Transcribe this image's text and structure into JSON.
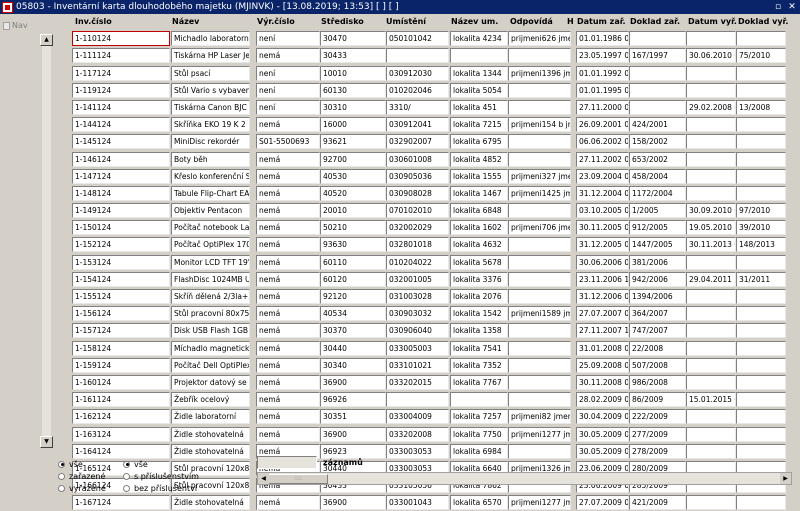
{
  "window": {
    "title": "05803 - Inventární karta dlouhodobého majetku (MJINVK) - [13.08.2019; 13:53]  [ ]  [ ]",
    "restore_icon": "restore-icon",
    "close_icon": "close-icon"
  },
  "nav": {
    "label": "Nav"
  },
  "columns": {
    "inv": "Inv.číslo",
    "nazev": "Název",
    "vyr": "Výr.číslo",
    "stredisko": "Středisko",
    "umisteni": "Umístění",
    "nazev_um": "Název um.",
    "odpovida": "Odpovídá",
    "h": "H",
    "datum_zar": "Datum zař.",
    "doklad_zar": "Doklad zař.",
    "datum_vyr": "Datum vyř.",
    "doklad_vyr": "Doklad vyř."
  },
  "rows": [
    [
      "1-110124",
      "Michadlo laboratorní",
      "není",
      "30470",
      "050101042",
      "lokalita 4234",
      "prijmeni626 jmer",
      "01.01.1986 0",
      "",
      "",
      ""
    ],
    [
      "1-111124",
      "Tiskárna HP Laser Je",
      "nemá",
      "30433",
      "",
      "",
      "",
      "23.05.1997 0",
      "167/1997",
      "30.06.2010 0",
      "75/2010"
    ],
    [
      "1-117124",
      "Stůl psací",
      "není",
      "10010",
      "030912030",
      "lokalita 1344",
      "prijmeni1396 jme",
      "01.01.1992 0",
      "",
      "",
      ""
    ],
    [
      "1-119124",
      "Stůl Vario s vybaven",
      "není",
      "60130",
      "010202046",
      "lokalita 5054",
      "",
      "01.01.1995 0",
      "",
      "",
      ""
    ],
    [
      "1-141124",
      "Tiskárna Canon BJC",
      "není",
      "30310",
      "3310/",
      "lokalita 451",
      "",
      "27.11.2000 0",
      "",
      "29.02.2008 0",
      "13/2008"
    ],
    [
      "1-144124",
      "Skříňka EKO 19 K 2",
      "nemá",
      "16000",
      "030912041",
      "lokalita 7215",
      "prijmeni154 b jm",
      "26.09.2001 0",
      "424/2001",
      "",
      ""
    ],
    [
      "1-145124",
      "MiniDisc rekordér",
      "S01-5500693",
      "93621",
      "032902007",
      "lokalita 6795",
      "",
      "06.06.2002 0",
      "158/2002",
      "",
      ""
    ],
    [
      "1-146124",
      "Boty běh",
      "nemá",
      "92700",
      "030601008",
      "lokalita 4852",
      "",
      "27.11.2002 0",
      "653/2002",
      "",
      ""
    ],
    [
      "1-147124",
      "Křeslo konferenční S",
      "nemá",
      "40530",
      "030905036",
      "lokalita 1555",
      "prijmeni327 jmer",
      "23.09.2004 0",
      "458/2004",
      "",
      ""
    ],
    [
      "1-148124",
      "Tabule Flip-Chart EA",
      "nemá",
      "40520",
      "030908028",
      "lokalita 1467",
      "prijmeni1425 jme",
      "31.12.2004 0",
      "1172/2004",
      "",
      ""
    ],
    [
      "1-149124",
      "Objektiv Pentacon",
      "nemá",
      "20010",
      "070102010",
      "lokalita 6848",
      "",
      "03.10.2005 0",
      "1/2005",
      "30.09.2010 0",
      "97/2010"
    ],
    [
      "1-150124",
      "Počítač notebook Lat",
      "nemá",
      "50210",
      "032002029",
      "lokalita 1602",
      "prijmeni706 jmer",
      "30.11.2005 0",
      "912/2005",
      "19.05.2010 1",
      "39/2010"
    ],
    [
      "1-152124",
      "Počítač OptiPlex 170",
      "nemá",
      "93630",
      "032801018",
      "lokalita 4632",
      "",
      "31.12.2005 0",
      "1447/2005",
      "30.11.2013 0",
      "148/2013"
    ],
    [
      "1-153124",
      "Monitor LCD TFT 19\"",
      "nemá",
      "60110",
      "010204022",
      "lokalita 5678",
      "",
      "30.06.2006 0",
      "381/2006",
      "",
      ""
    ],
    [
      "1-154124",
      "FlashDisc 1024MB U",
      "nemá",
      "60120",
      "032001005",
      "lokalita 3376",
      "",
      "23.11.2006 1",
      "942/2006",
      "29.04.2011 1",
      "31/2011"
    ],
    [
      "1-155124",
      "Skříň dělená 2/3la+3/",
      "nemá",
      "92120",
      "031003028",
      "lokalita 2076",
      "",
      "31.12.2006 0",
      "1394/2006",
      "",
      ""
    ],
    [
      "1-156124",
      "Stůl pracovní 80x75x",
      "nemá",
      "40534",
      "030903032",
      "lokalita 1542",
      "prijmeni1589 jme",
      "27.07.2007 0",
      "364/2007",
      "",
      ""
    ],
    [
      "1-157124",
      "Disk USB Flash 1GB",
      "nemá",
      "30370",
      "030906040",
      "lokalita 1358",
      "",
      "27.11.2007 1",
      "747/2007",
      "",
      ""
    ],
    [
      "1-158124",
      "Míchadlo magnetické",
      "nemá",
      "30440",
      "033005003",
      "lokalita 7541",
      "",
      "31.01.2008 0",
      "22/2008",
      "",
      ""
    ],
    [
      "1-159124",
      "Počítač Dell OptiPlex",
      "nemá",
      "30340",
      "033101021",
      "lokalita 7352",
      "",
      "25.09.2008 0",
      "507/2008",
      "",
      ""
    ],
    [
      "1-160124",
      "Projektor datový se s",
      "nemá",
      "36900",
      "033202015",
      "lokalita 7767",
      "",
      "30.11.2008 0",
      "986/2008",
      "",
      ""
    ],
    [
      "1-161124",
      "Žebřík ocelový",
      "nemá",
      "96926",
      "",
      "",
      "",
      "28.02.2009 0",
      "86/2009",
      "15.01.2015 0",
      ""
    ],
    [
      "1-162124",
      "Židle laboratorní",
      "nemá",
      "30351",
      "033004009",
      "lokalita 7257",
      "prijmeni82 jmeno",
      "30.04.2009 0",
      "222/2009",
      "",
      ""
    ],
    [
      "1-163124",
      "Židle stohovatelná",
      "nemá",
      "36900",
      "033202008",
      "lokalita 7750",
      "prijmeni1277 jme",
      "30.05.2009 0",
      "277/2009",
      "",
      ""
    ],
    [
      "1-164124",
      "Židle stohovatelná",
      "nemá",
      "96923",
      "033003053",
      "lokalita 6984",
      "",
      "30.05.2009 0",
      "278/2009",
      "",
      ""
    ],
    [
      "1-165124",
      "Stůl pracovní 120x80",
      "nemá",
      "30440",
      "033003053",
      "lokalita 6640",
      "prijmeni1326 jme",
      "23.06.2009 0",
      "280/2009",
      "",
      ""
    ],
    [
      "1-166124",
      "Stůl pracovní 120x80",
      "nemá",
      "30433",
      "033105056",
      "lokalita 7862",
      "",
      "23.06.2009 0",
      "285/2009",
      "",
      ""
    ],
    [
      "1-167124",
      "Židle stohovatelná",
      "nemá",
      "36900",
      "033001043",
      "lokalita 6570",
      "prijmeni1277 jme",
      "27.07.2009 0",
      "421/2009",
      "",
      ""
    ]
  ],
  "footer": {
    "count_value": "",
    "count_label": "záznamů"
  },
  "filter1": {
    "options": [
      "vše",
      "zařazené",
      "vyřazené"
    ],
    "selected": 0
  },
  "filter2": {
    "options": [
      "vše",
      "s příslušenstvím",
      "bez příslušentví"
    ],
    "selected": 0
  },
  "colors": {
    "titlebar": "#0a246a",
    "window_bg": "#d4d0c8",
    "focus_border": "#c00000"
  }
}
